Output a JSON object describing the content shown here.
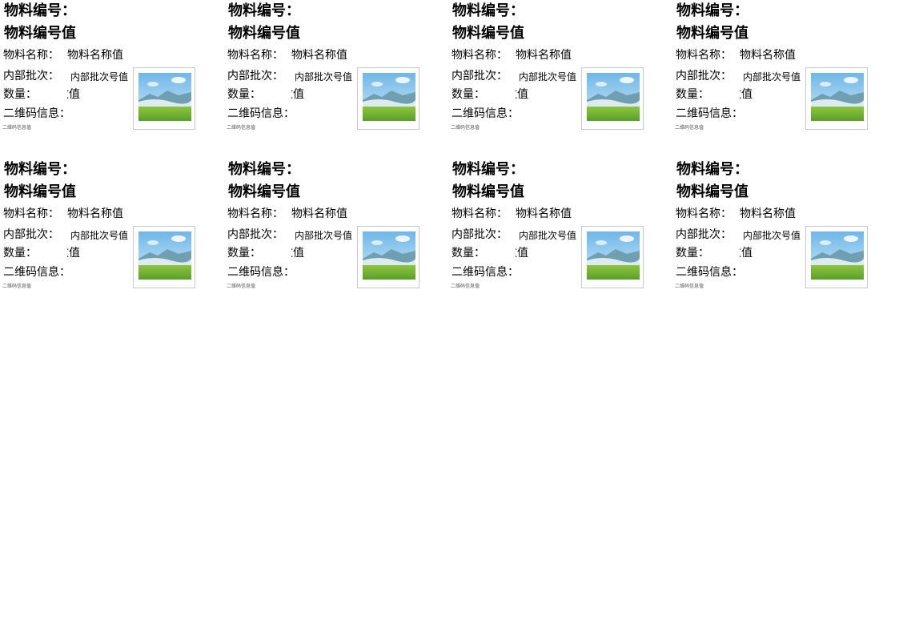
{
  "labels": [
    {
      "code_title": "物料编号：",
      "code_value": "物料编号值",
      "name_label": "物料名称：",
      "name_value": "物料名称值",
      "batch_label": "内部批次：",
      "batch_value": "内部批次号值",
      "qty_label": "数量：",
      "qty_value": "数值",
      "qr_label": "二维码信息：",
      "qr_value": "二维码信息值",
      "image_icon": "landscape-image-placeholder"
    },
    {
      "code_title": "物料编号：",
      "code_value": "物料编号值",
      "name_label": "物料名称：",
      "name_value": "物料名称值",
      "batch_label": "内部批次：",
      "batch_value": "内部批次号值",
      "qty_label": "数量：",
      "qty_value": "数值",
      "qr_label": "二维码信息：",
      "qr_value": "二维码信息值",
      "image_icon": "landscape-image-placeholder"
    },
    {
      "code_title": "物料编号：",
      "code_value": "物料编号值",
      "name_label": "物料名称：",
      "name_value": "物料名称值",
      "batch_label": "内部批次：",
      "batch_value": "内部批次号值",
      "qty_label": "数量：",
      "qty_value": "数值",
      "qr_label": "二维码信息：",
      "qr_value": "二维码信息值",
      "image_icon": "landscape-image-placeholder"
    },
    {
      "code_title": "物料编号：",
      "code_value": "物料编号值",
      "name_label": "物料名称：",
      "name_value": "物料名称值",
      "batch_label": "内部批次：",
      "batch_value": "内部批次号值",
      "qty_label": "数量：",
      "qty_value": "数值",
      "qr_label": "二维码信息：",
      "qr_value": "二维码信息值",
      "image_icon": "landscape-image-placeholder"
    },
    {
      "code_title": "物料编号：",
      "code_value": "物料编号值",
      "name_label": "物料名称：",
      "name_value": "物料名称值",
      "batch_label": "内部批次：",
      "batch_value": "内部批次号值",
      "qty_label": "数量：",
      "qty_value": "数值",
      "qr_label": "二维码信息：",
      "qr_value": "二维码信息值",
      "image_icon": "landscape-image-placeholder"
    },
    {
      "code_title": "物料编号：",
      "code_value": "物料编号值",
      "name_label": "物料名称：",
      "name_value": "物料名称值",
      "batch_label": "内部批次：",
      "batch_value": "内部批次号值",
      "qty_label": "数量：",
      "qty_value": "数值",
      "qr_label": "二维码信息：",
      "qr_value": "二维码信息值",
      "image_icon": "landscape-image-placeholder"
    },
    {
      "code_title": "物料编号：",
      "code_value": "物料编号值",
      "name_label": "物料名称：",
      "name_value": "物料名称值",
      "batch_label": "内部批次：",
      "batch_value": "内部批次号值",
      "qty_label": "数量：",
      "qty_value": "数值",
      "qr_label": "二维码信息：",
      "qr_value": "二维码信息值",
      "image_icon": "landscape-image-placeholder"
    },
    {
      "code_title": "物料编号：",
      "code_value": "物料编号值",
      "name_label": "物料名称：",
      "name_value": "物料名称值",
      "batch_label": "内部批次：",
      "batch_value": "内部批次号值",
      "qty_label": "数量：",
      "qty_value": "数值",
      "qr_label": "二维码信息：",
      "qr_value": "二维码信息值",
      "image_icon": "landscape-image-placeholder"
    }
  ]
}
